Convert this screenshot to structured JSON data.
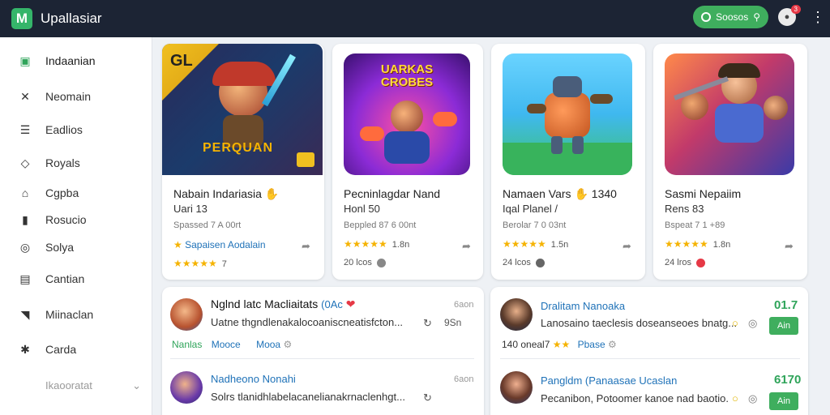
{
  "app": {
    "logo": "M",
    "title": "Upallasiar"
  },
  "topbar": {
    "search_label": "Soosos",
    "notif_count": "3",
    "menu_icon": "kebab-icon"
  },
  "sidebar": {
    "items": [
      {
        "label": "Indaanian",
        "icon": "store-icon"
      },
      {
        "label": "Neomain",
        "icon": "tools-icon"
      },
      {
        "label": "Eadlios",
        "icon": "list-icon"
      },
      {
        "label": "Royals",
        "icon": "tag-icon"
      },
      {
        "label": "Cgpba",
        "icon": "home-icon"
      },
      {
        "label": "Rosucio",
        "icon": "bookmark-icon"
      },
      {
        "label": "Solya",
        "icon": "circle-icon"
      },
      {
        "label": "Cantian",
        "icon": "document-icon"
      },
      {
        "label": "Miinaclan",
        "icon": "chart-icon"
      },
      {
        "label": "Carda",
        "icon": "puzzle-icon"
      }
    ],
    "footer_label": "Ikaooratat"
  },
  "cards": [
    {
      "title": "Nabain Indariasia",
      "title_icon": "✋",
      "sub1": "Uari 13",
      "sub2": "Spassed 7 A 00rt",
      "tag": "Sapaisen Aodalain",
      "stars": "★★★★★",
      "rating": "7",
      "thumb_text": "GL",
      "thumb_caption": "PERQUAN"
    },
    {
      "title": "Pecninlagdar Nand",
      "sub1": "Honl 50",
      "sub2": "Beppled 87 6 00nt",
      "stars": "★★★★★",
      "rating": "1.8n",
      "footer": "20 lcos",
      "thumb_text": "UARKAS CROBES"
    },
    {
      "title": "Namaen Vars",
      "title_icon": "✋",
      "title_extra": "1340",
      "sub1": "Iqal Planel /",
      "sub2": "Berolar 7 0 03nt",
      "stars": "★★★★★",
      "rating": "1.5n",
      "footer": "24 lcos"
    },
    {
      "title": "Sasmi Nepaiim",
      "sub1": "Rens 83",
      "sub2": "Bspeat 7 1 +89",
      "stars": "★★★★★",
      "rating": "1.8n",
      "footer": "24 lros"
    }
  ],
  "list_left": [
    {
      "title": "Nglnd latc Macliaitats",
      "title_extra": "(0Ac",
      "desc": "Uatne thgndlenakalocoaniscneatisfcton...",
      "meta": "6aon",
      "side": "9Sn",
      "tag1": "Nanlas",
      "tag2": "Mooce",
      "tag3": "Mooa"
    },
    {
      "title": "Nadheono Nonahi",
      "desc": "Solrs tlanidhlabelacanelianakrnaclenhgt...",
      "meta": "6aon"
    }
  ],
  "list_right": [
    {
      "title": "Dralitam Nanoaka",
      "desc": "Lanosaino taeclesis doseanseoes bnatg...",
      "price": "01.7",
      "buy": "Ain",
      "meta1": "140 oneal7",
      "meta2": "Pbase"
    },
    {
      "title": "Pangldm (Panaasae Ucaslan",
      "desc": "Pecanibon, Potoomer kanoe nad baotio.",
      "price": "6170",
      "buy": "Ain"
    }
  ],
  "colors": {
    "accent": "#3fae5e",
    "topbar": "#1c2434",
    "link": "#1f72b8"
  }
}
